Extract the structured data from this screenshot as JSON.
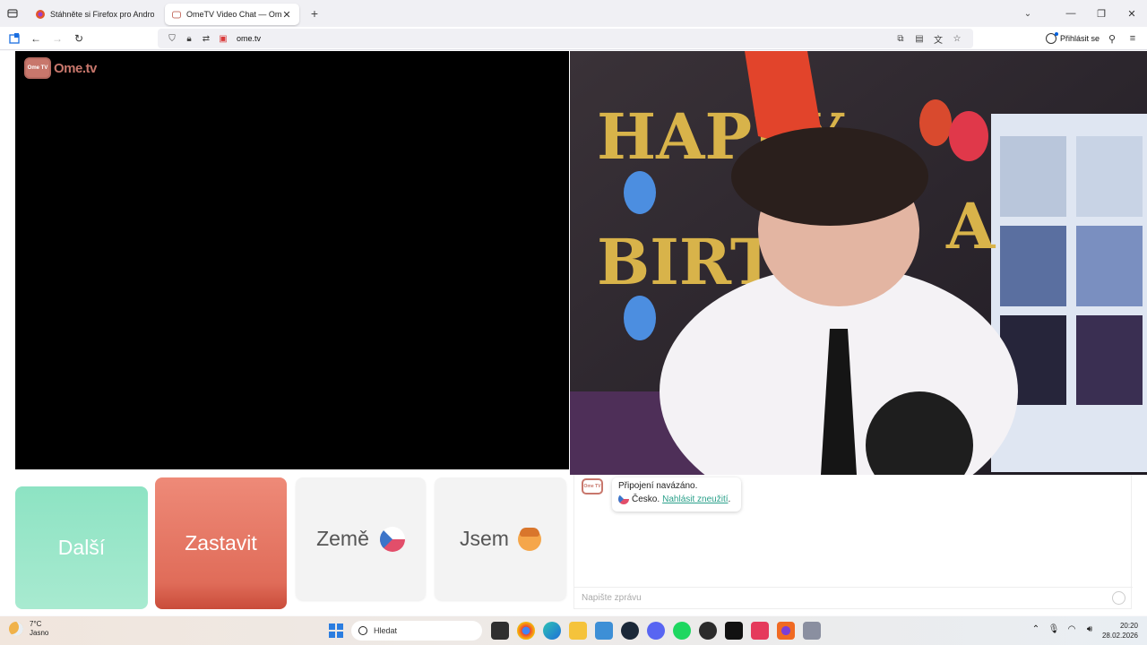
{
  "browser": {
    "tabs": [
      {
        "title": "Stáhněte si Firefox pro Android",
        "active": false
      },
      {
        "title": "OmeTV Video Chat — Omegle",
        "active": true
      }
    ],
    "url": "ome.tv",
    "signin_label": "Přihlásit se"
  },
  "page": {
    "logo_text": "Ome.tv",
    "logo_badge": "Ome TV",
    "buttons": {
      "next": "Další",
      "stop": "Zastavit",
      "country": "Země",
      "gender": "Jsem"
    },
    "chat": {
      "status": "Připojení navázáno.",
      "country": "Česko.",
      "report_link": "Nahlásit zneužití",
      "report_suffix": ".",
      "placeholder": "Napište zprávu"
    }
  },
  "taskbar": {
    "weather_temp": "7°C",
    "weather_desc": "Jasno",
    "search_label": "Hledat",
    "time": "20:20",
    "date": "28.02.2026",
    "pinned_icons": [
      "task-view-icon",
      "chrome-icon",
      "edge-icon",
      "file-explorer-icon",
      "notepad-icon",
      "steam-icon",
      "discord-icon",
      "spotify-icon",
      "obs-icon",
      "capcut-icon",
      "tiktok-icon",
      "firefox-icon",
      "settings-icon"
    ]
  },
  "colors": {
    "next": "#8de3c3",
    "stop": "#e06c59",
    "link": "#2aa08a",
    "brand": "#c8776c"
  }
}
